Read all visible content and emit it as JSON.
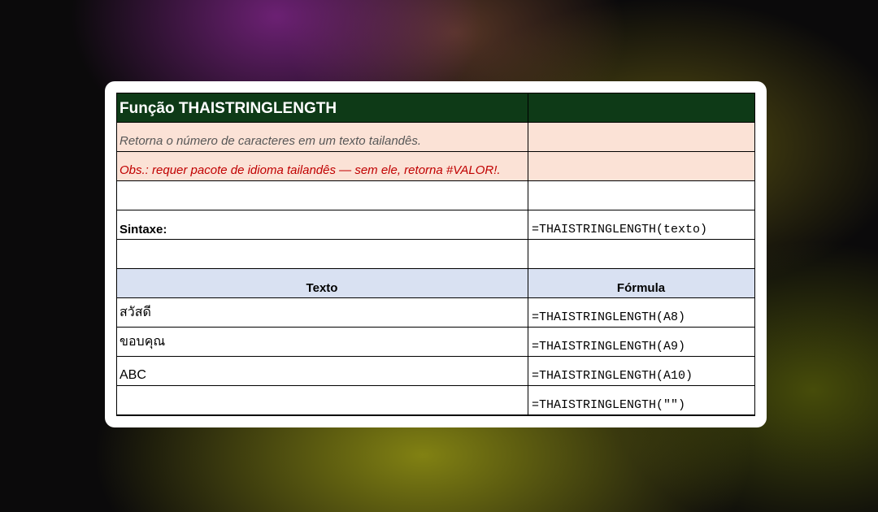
{
  "sheet": {
    "title": "Função THAISTRINGLENGTH",
    "description": "Retorna o número de caracteres em um texto tailandês.",
    "note": "Obs.: requer pacote de idioma tailandês — sem ele, retorna #VALOR!.",
    "syntax_label": "Sintaxe:",
    "syntax_value": "=THAISTRINGLENGTH(texto)",
    "headers": {
      "text": "Texto",
      "formula": "Fórmula"
    },
    "rows": [
      {
        "text": "สวัสดี",
        "formula": "=THAISTRINGLENGTH(A8)"
      },
      {
        "text": "ขอบคุณ",
        "formula": "=THAISTRINGLENGTH(A9)"
      },
      {
        "text": "ABC",
        "formula": "=THAISTRINGLENGTH(A10)"
      },
      {
        "text": "",
        "formula": "=THAISTRINGLENGTH(\"\")"
      }
    ]
  },
  "colors": {
    "title_bg": "#0e3a17",
    "pink_bg": "#fbe2d6",
    "header_bg": "#d9e1f2",
    "note_text": "#c00000"
  }
}
